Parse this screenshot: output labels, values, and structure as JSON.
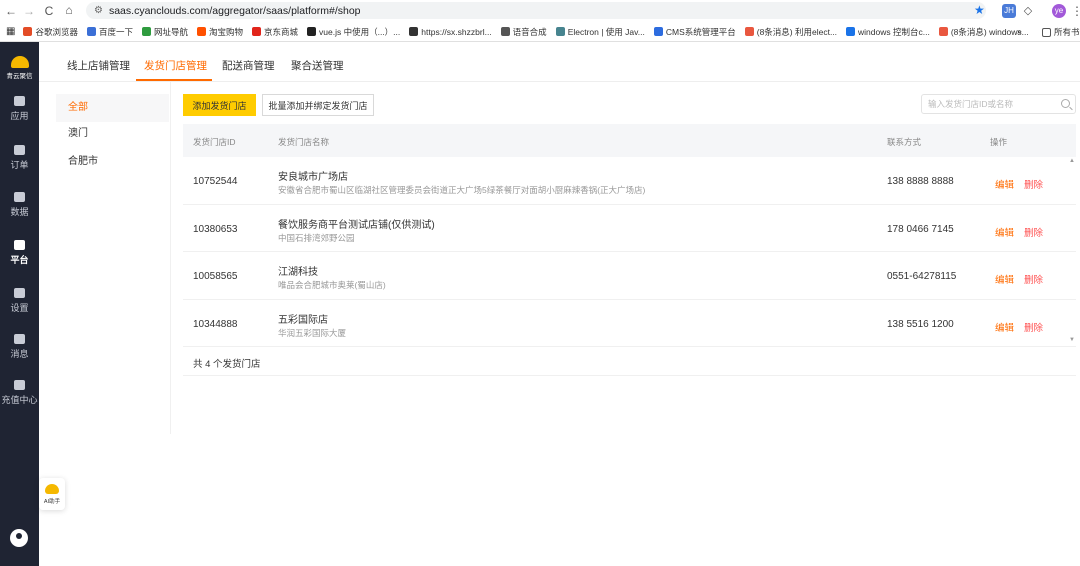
{
  "browser": {
    "url": "saas.cyanclouds.com/aggregator/saas/platform#/shop",
    "extensions": [
      "JH",
      "ye"
    ],
    "bookmarks": [
      {
        "label": "谷歌浏览器",
        "color": "#e34c26"
      },
      {
        "label": "百度一下",
        "color": "#3b6fd6"
      },
      {
        "label": "网址导航",
        "color": "#2e9b3e"
      },
      {
        "label": "淘宝购物",
        "color": "#ff5000"
      },
      {
        "label": "京东商城",
        "color": "#e1251b"
      },
      {
        "label": "vue.js 中使用（...）...",
        "color": "#222222"
      },
      {
        "label": "https://sx.shzzbrl...",
        "color": "#333333"
      },
      {
        "label": "语音合成",
        "color": "#555555"
      },
      {
        "label": "Electron | 使用 Jav...",
        "color": "#47848f"
      },
      {
        "label": "CMS系统管理平台",
        "color": "#2d6cdf"
      },
      {
        "label": "(8条消息) 利用elect...",
        "color": "#e9573f"
      },
      {
        "label": "windows 控制台c...",
        "color": "#1a73e8"
      },
      {
        "label": "(8条消息) windows...",
        "color": "#e9573f"
      }
    ],
    "all_bookmarks": "所有书签"
  },
  "sidebar": {
    "logo_text": "青云聚信",
    "items": [
      {
        "label": "应用",
        "active": false
      },
      {
        "label": "订单",
        "active": false
      },
      {
        "label": "数据",
        "active": false
      },
      {
        "label": "平台",
        "active": true
      },
      {
        "label": "设置",
        "active": false
      },
      {
        "label": "消息",
        "active": false
      },
      {
        "label": "充值中心",
        "active": false
      }
    ]
  },
  "tabs": [
    {
      "label": "线上店铺管理",
      "active": false
    },
    {
      "label": "发货门店管理",
      "active": true
    },
    {
      "label": "配送商管理",
      "active": false
    },
    {
      "label": "聚合送管理",
      "active": false
    }
  ],
  "regions": [
    {
      "label": "全部",
      "active": true
    },
    {
      "label": "澳门",
      "active": false
    },
    {
      "label": "合肥市",
      "active": false
    }
  ],
  "actions": {
    "add": "添加发货门店",
    "batch": "批量添加并绑定发货门店"
  },
  "search": {
    "placeholder": "输入发货门店ID或名称"
  },
  "table": {
    "headers": {
      "id": "发货门店ID",
      "name": "发货门店名称",
      "contact": "联系方式",
      "op": "操作"
    },
    "rows": [
      {
        "id": "10752544",
        "name": "安良城市广场店",
        "addr": "安徽省合肥市蜀山区临湖社区管理委员会街道正大广场5绿茶餐厅对面胡小厨麻辣香锅(正大广场店)",
        "phone": "138 8888 8888"
      },
      {
        "id": "10380653",
        "name": "餐饮服务商平台测试店铺(仅供测试)",
        "addr": "中国石排湾郊野公园",
        "phone": "178 0466 7145"
      },
      {
        "id": "10058565",
        "name": "江湖科技",
        "addr": "唯品会合肥城市奥莱(蜀山店)",
        "phone": "0551-64278115"
      },
      {
        "id": "10344888",
        "name": "五彩国际店",
        "addr": "华润五彩国际大厦",
        "phone": "138 5516 1200"
      }
    ],
    "edit_label": "编辑",
    "delete_label": "删除",
    "total": "共 4 个发货门店"
  },
  "helper": {
    "label": "AI助手"
  }
}
